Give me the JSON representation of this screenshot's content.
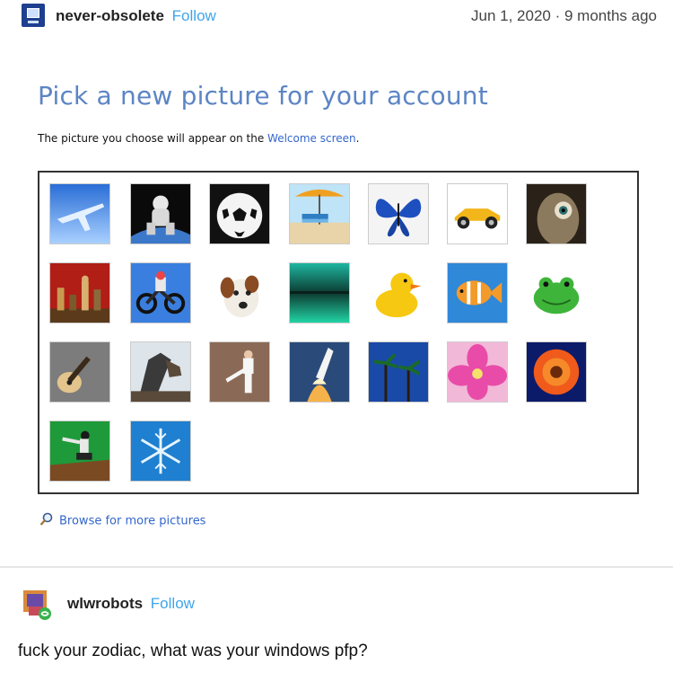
{
  "post1": {
    "username": "never-obsolete",
    "follow_label": "Follow",
    "timestamp": "Jun 1, 2020 · 9 months ago"
  },
  "picker": {
    "title": "Pick a new picture for your account",
    "subtitle_prefix": "The picture you choose will appear on the ",
    "subtitle_link": "Welcome screen",
    "subtitle_suffix": ".",
    "browse_label": "Browse for more pictures",
    "pictures": [
      "airplane",
      "astronaut",
      "soccer-ball",
      "beach-chair",
      "butterfly",
      "race-car",
      "owl",
      "chess",
      "dirt-bike",
      "dog",
      "aurora",
      "rubber-duck",
      "fish",
      "frog",
      "guitar",
      "horse",
      "karate",
      "space-shuttle",
      "palm-trees",
      "pink-flower",
      "orange-flower",
      "skateboarder",
      "snowflake"
    ]
  },
  "post2": {
    "username": "wlwrobots",
    "follow_label": "Follow",
    "text": "fuck your zodiac, what was your windows pfp?"
  }
}
